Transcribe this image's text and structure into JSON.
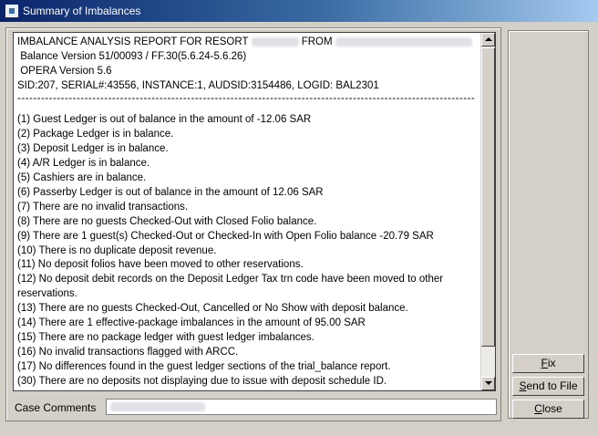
{
  "window": {
    "title": "Summary of Imbalances"
  },
  "report": {
    "header_prefix": "IMBALANCE ANALYSIS REPORT FOR RESORT",
    "header_from": "FROM",
    "balance_version": "Balance Version 51/00093 / FF.30(5.6.24-5.6.26)",
    "opera_version": "OPERA Version 5.6",
    "session_info": "SID:207, SERIAL#:43556, INSTANCE:1, AUDSID:3154486, LOGID: BAL2301",
    "separator": "--------------------------------------------------------------------------------------------------------------------",
    "lines": [
      "(1) Guest Ledger is out of balance in the amount of -12.06 SAR",
      "(2) Package Ledger is in balance.",
      "(3) Deposit Ledger is in balance.",
      "(4) A/R Ledger is in balance.",
      "(5) Cashiers are in balance.",
      "(6) Passerby Ledger is out of balance in the amount of 12.06 SAR",
      "(7) There are no invalid transactions.",
      "(8) There are no guests Checked-Out with Closed Folio balance.",
      "(9) There are 1 guest(s) Checked-Out or Checked-In with Open Folio balance -20.79 SAR",
      "(10) There is no duplicate deposit revenue.",
      "(11) No deposit folios have been moved to other reservations.",
      "(12) No deposit debit records on the Deposit Ledger Tax trn code have been moved to other reservations.",
      "(13) There are no guests Checked-Out, Cancelled or No Show with deposit balance.",
      "(14) There are 1 effective-package imbalances in the amount of 95.00 SAR",
      "(15) There are no package ledger with guest ledger imbalances.",
      "(16) No invalid transactions flagged with ARCC.",
      "(17) No differences found in the guest ledger sections of the trial_balance report.",
      "(30) There are no deposits not displaying due to issue with deposit schedule ID."
    ]
  },
  "case_comments": {
    "label": "Case Comments"
  },
  "buttons": {
    "fix": {
      "accel": "F",
      "rest": "ix"
    },
    "send_to_file": {
      "accel": "S",
      "rest": "end to File"
    },
    "close": {
      "accel": "C",
      "rest": "lose"
    }
  }
}
